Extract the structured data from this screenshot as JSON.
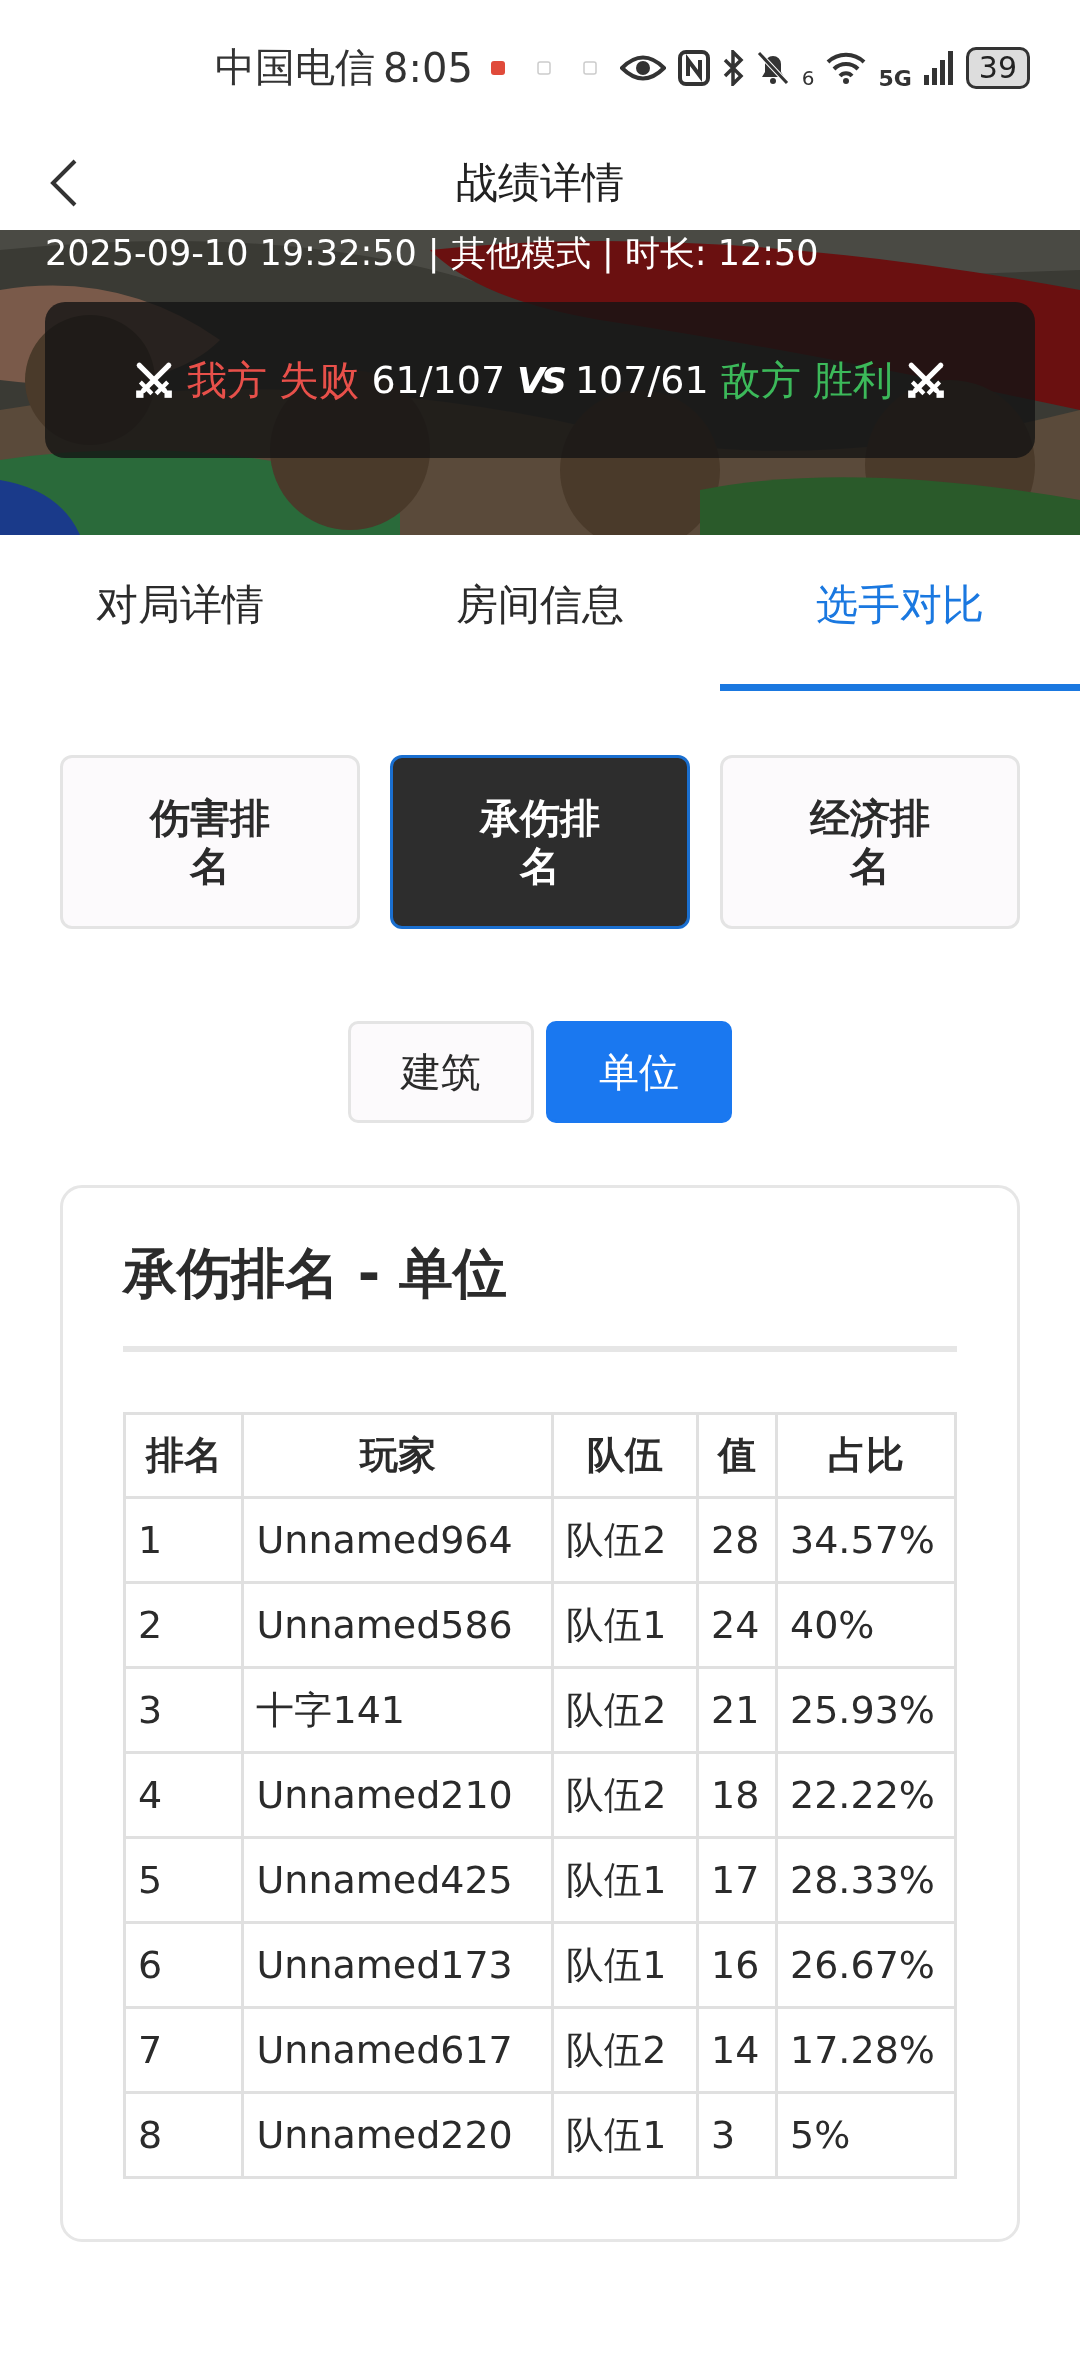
{
  "status_bar": {
    "carrier": "中国电信",
    "time": "8:05",
    "wifi_badge": "6",
    "network": "5G",
    "battery": "39"
  },
  "header": {
    "title": "战绩详情"
  },
  "match": {
    "info": "2025-09-10 19:32:50 | 其他模式 | 时长: 12:50",
    "vs": "VS",
    "sides": [
      {
        "name": "我方",
        "result": "失败",
        "score": "61/107",
        "kind": "loss"
      },
      {
        "name": "敌方",
        "result": "胜利",
        "score": "107/61",
        "kind": "win"
      }
    ]
  },
  "tabs": [
    {
      "label": "对局详情",
      "selected": false
    },
    {
      "label": "房间信息",
      "selected": false
    },
    {
      "label": "选手对比",
      "selected": true
    }
  ],
  "ranking_types": [
    {
      "label": "伤害排名",
      "selected": false
    },
    {
      "label": "承伤排名",
      "selected": true
    },
    {
      "label": "经济排名",
      "selected": false
    }
  ],
  "target_toggle": [
    {
      "label": "建筑",
      "selected": false
    },
    {
      "label": "单位",
      "selected": true
    }
  ],
  "card": {
    "title": "承伤排名 - 单位"
  },
  "table": {
    "columns": [
      "排名",
      "玩家",
      "队伍",
      "值",
      "占比"
    ],
    "rows": [
      [
        "1",
        "Unnamed964",
        "队伍2",
        "28",
        "34.57%"
      ],
      [
        "2",
        "Unnamed586",
        "队伍1",
        "24",
        "40%"
      ],
      [
        "3",
        "十字141",
        "队伍2",
        "21",
        "25.93%"
      ],
      [
        "4",
        "Unnamed210",
        "队伍2",
        "18",
        "22.22%"
      ],
      [
        "5",
        "Unnamed425",
        "队伍1",
        "17",
        "28.33%"
      ],
      [
        "6",
        "Unnamed173",
        "队伍1",
        "16",
        "26.67%"
      ],
      [
        "7",
        "Unnamed617",
        "队伍2",
        "14",
        "17.28%"
      ],
      [
        "8",
        "Unnamed220",
        "队伍1",
        "3",
        "5%"
      ]
    ]
  }
}
